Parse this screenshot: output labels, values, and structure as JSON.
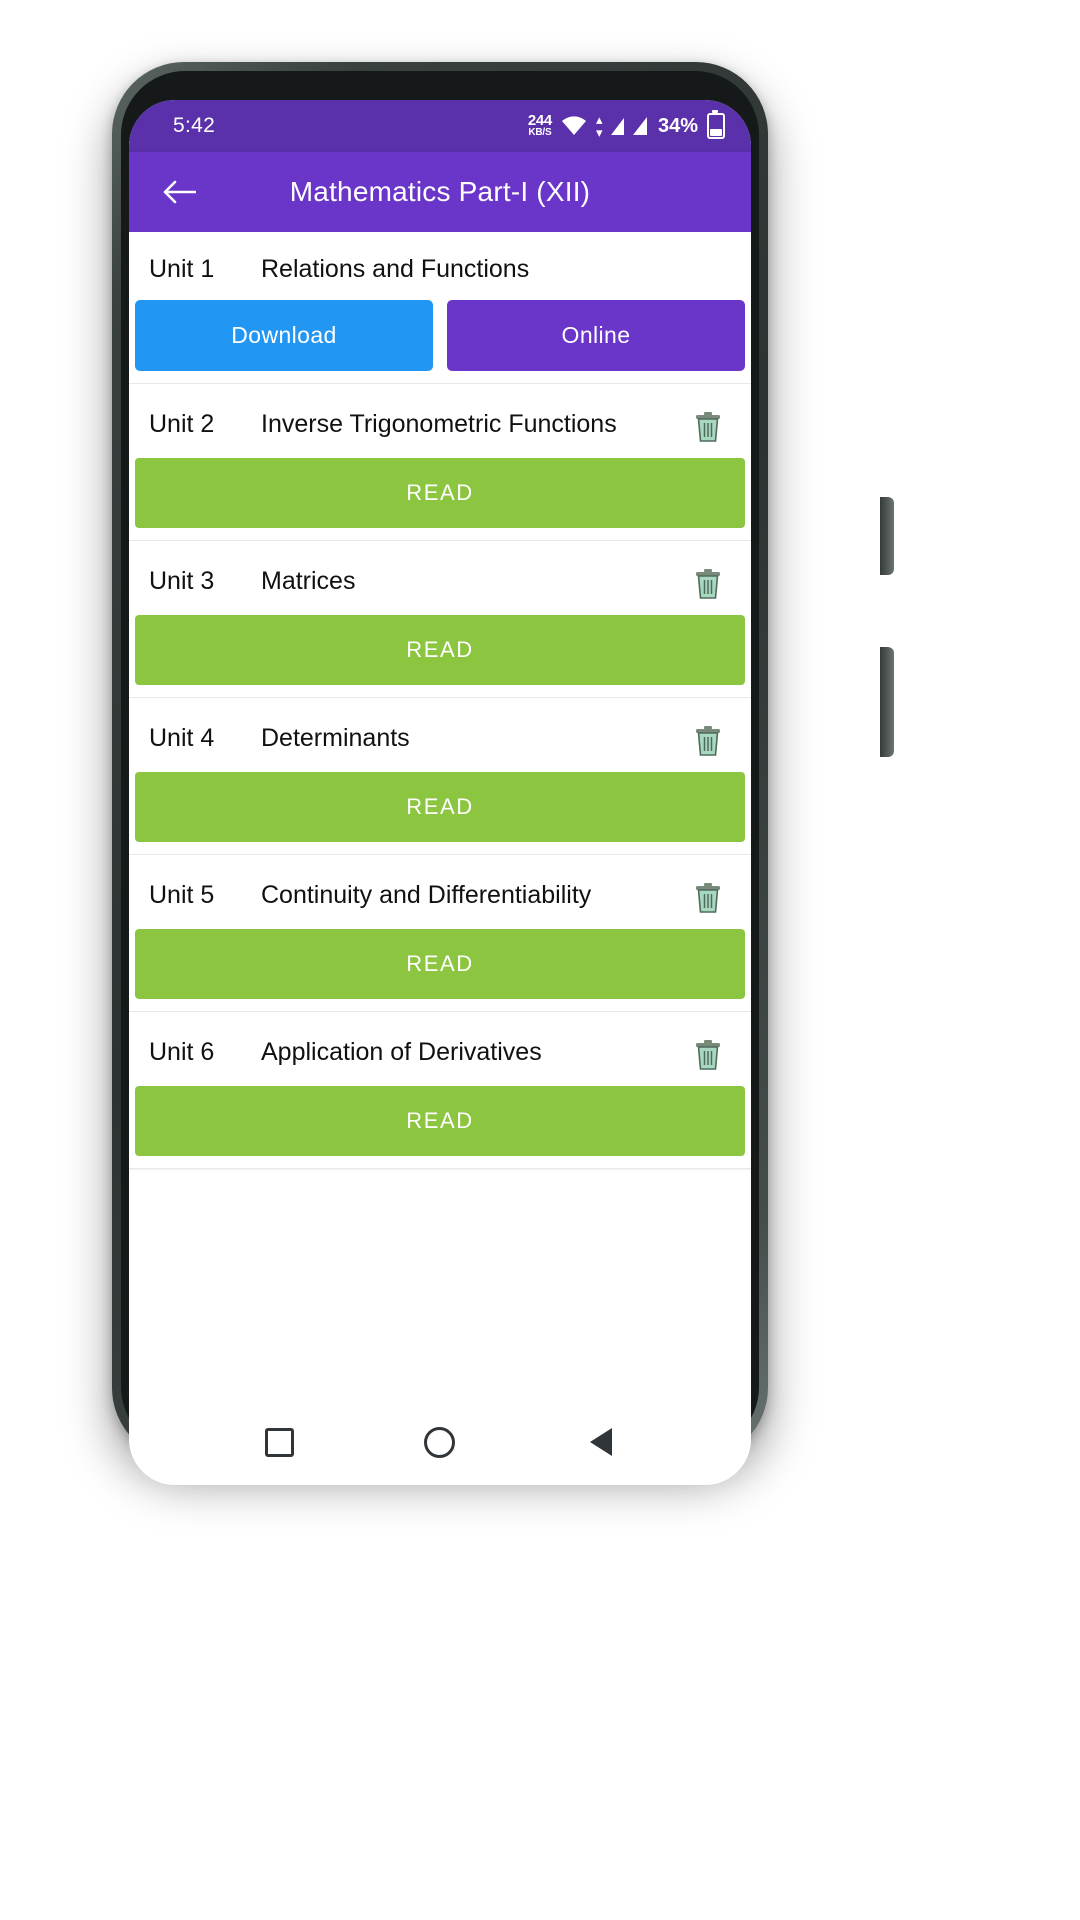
{
  "status_bar": {
    "time": "5:42",
    "net_speed_value": "244",
    "net_speed_unit": "KB/S",
    "wifi_icon": "wifi-icon",
    "signal_icon": "signal-bars-icon",
    "battery_percent": "34%",
    "battery_icon": "battery-icon",
    "background": "#5b31ab"
  },
  "app_bar": {
    "back_icon": "arrow-left-icon",
    "title": "Mathematics Part-I (XII)",
    "background": "#6a35c9"
  },
  "colors": {
    "download_blue": "#2196f3",
    "online_purple": "#6a35c9",
    "read_green": "#8cc540",
    "accent_purple": "#6a35c9"
  },
  "units": [
    {
      "number": "Unit 1",
      "title": "Relations and Functions",
      "has_delete": false,
      "buttons": [
        {
          "label": "Download",
          "style": "btn-download",
          "name": "download-button"
        },
        {
          "label": "Online",
          "style": "btn-online",
          "name": "online-button"
        }
      ]
    },
    {
      "number": "Unit 2",
      "title": "Inverse Trigonometric Functions",
      "has_delete": true,
      "delete_icon": "trash-icon",
      "read_label": "READ"
    },
    {
      "number": "Unit 3",
      "title": "Matrices",
      "has_delete": true,
      "delete_icon": "trash-icon",
      "read_label": "READ"
    },
    {
      "number": "Unit 4",
      "title": "Determinants",
      "has_delete": true,
      "delete_icon": "trash-icon",
      "read_label": "READ"
    },
    {
      "number": "Unit 5",
      "title": "Continuity and Differentiability",
      "has_delete": true,
      "delete_icon": "trash-icon",
      "read_label": "READ"
    },
    {
      "number": "Unit 6",
      "title": "Application of Derivatives",
      "has_delete": true,
      "delete_icon": "trash-icon",
      "read_label": "READ"
    }
  ],
  "nav_bar": {
    "recents_icon": "square-recents-icon",
    "home_icon": "circle-home-icon",
    "back_icon": "triangle-back-icon"
  }
}
